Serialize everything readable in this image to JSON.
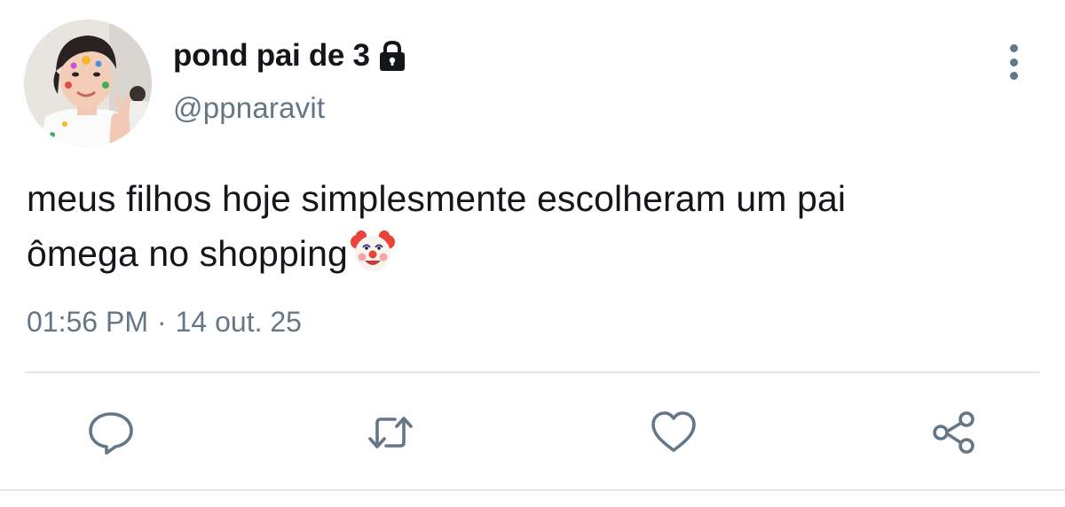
{
  "user": {
    "display_name": "pond pai de 3",
    "handle": "@ppnaravit",
    "protected_icon": "lock-icon"
  },
  "tweet": {
    "text_line1": "meus filhos hoje simplesmente escolheram um pai",
    "text_line2": "ômega no shopping",
    "emoji": "clown-face-emoji",
    "time": "01:56 PM",
    "separator": "·",
    "date": "14 out. 25"
  },
  "actions": {
    "reply": "reply-icon",
    "retweet": "retweet-icon",
    "like": "heart-icon",
    "share": "share-icon",
    "more": "more-vertical-icon"
  },
  "colors": {
    "text": "#14171a",
    "secondary": "#657786",
    "divider": "#e1e8ed",
    "background": "#ffffff"
  }
}
